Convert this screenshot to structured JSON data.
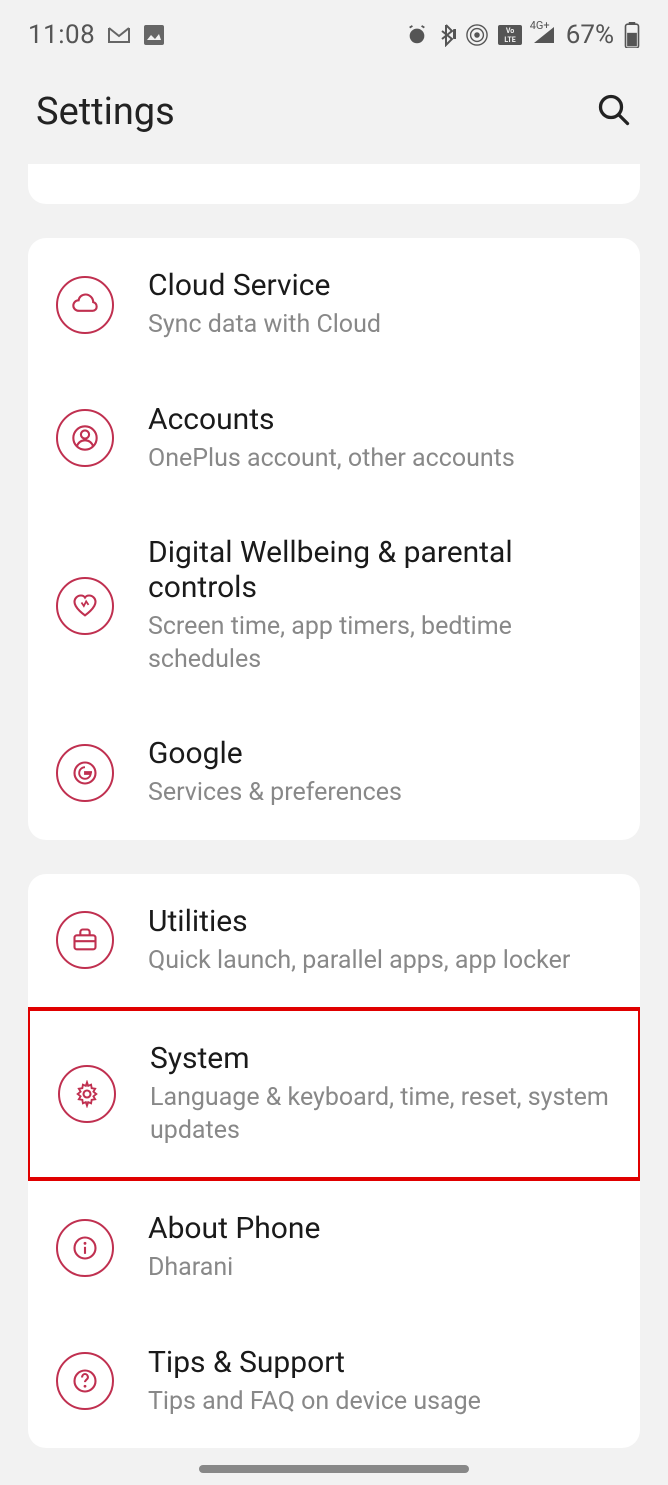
{
  "status_bar": {
    "time": "11:08",
    "battery_percent": "67%",
    "network_label": "4G+"
  },
  "header": {
    "title": "Settings"
  },
  "groups": [
    {
      "items": [
        {
          "id": "cloud-service",
          "title": "Cloud Service",
          "subtitle": "Sync data with Cloud",
          "icon": "cloud"
        },
        {
          "id": "accounts",
          "title": "Accounts",
          "subtitle": "OnePlus account, other accounts",
          "icon": "person"
        },
        {
          "id": "digital-wellbeing",
          "title": "Digital Wellbeing & parental controls",
          "subtitle": "Screen time, app timers, bedtime schedules",
          "icon": "heart"
        },
        {
          "id": "google",
          "title": "Google",
          "subtitle": "Services & preferences",
          "icon": "google"
        }
      ]
    },
    {
      "items": [
        {
          "id": "utilities",
          "title": "Utilities",
          "subtitle": "Quick launch, parallel apps, app locker",
          "icon": "briefcase"
        },
        {
          "id": "system",
          "title": "System",
          "subtitle": "Language & keyboard, time, reset, system updates",
          "icon": "gear",
          "highlighted": true
        },
        {
          "id": "about-phone",
          "title": "About Phone",
          "subtitle": "Dharani",
          "icon": "info"
        },
        {
          "id": "tips-support",
          "title": "Tips & Support",
          "subtitle": "Tips and FAQ on device usage",
          "icon": "help"
        }
      ]
    }
  ]
}
